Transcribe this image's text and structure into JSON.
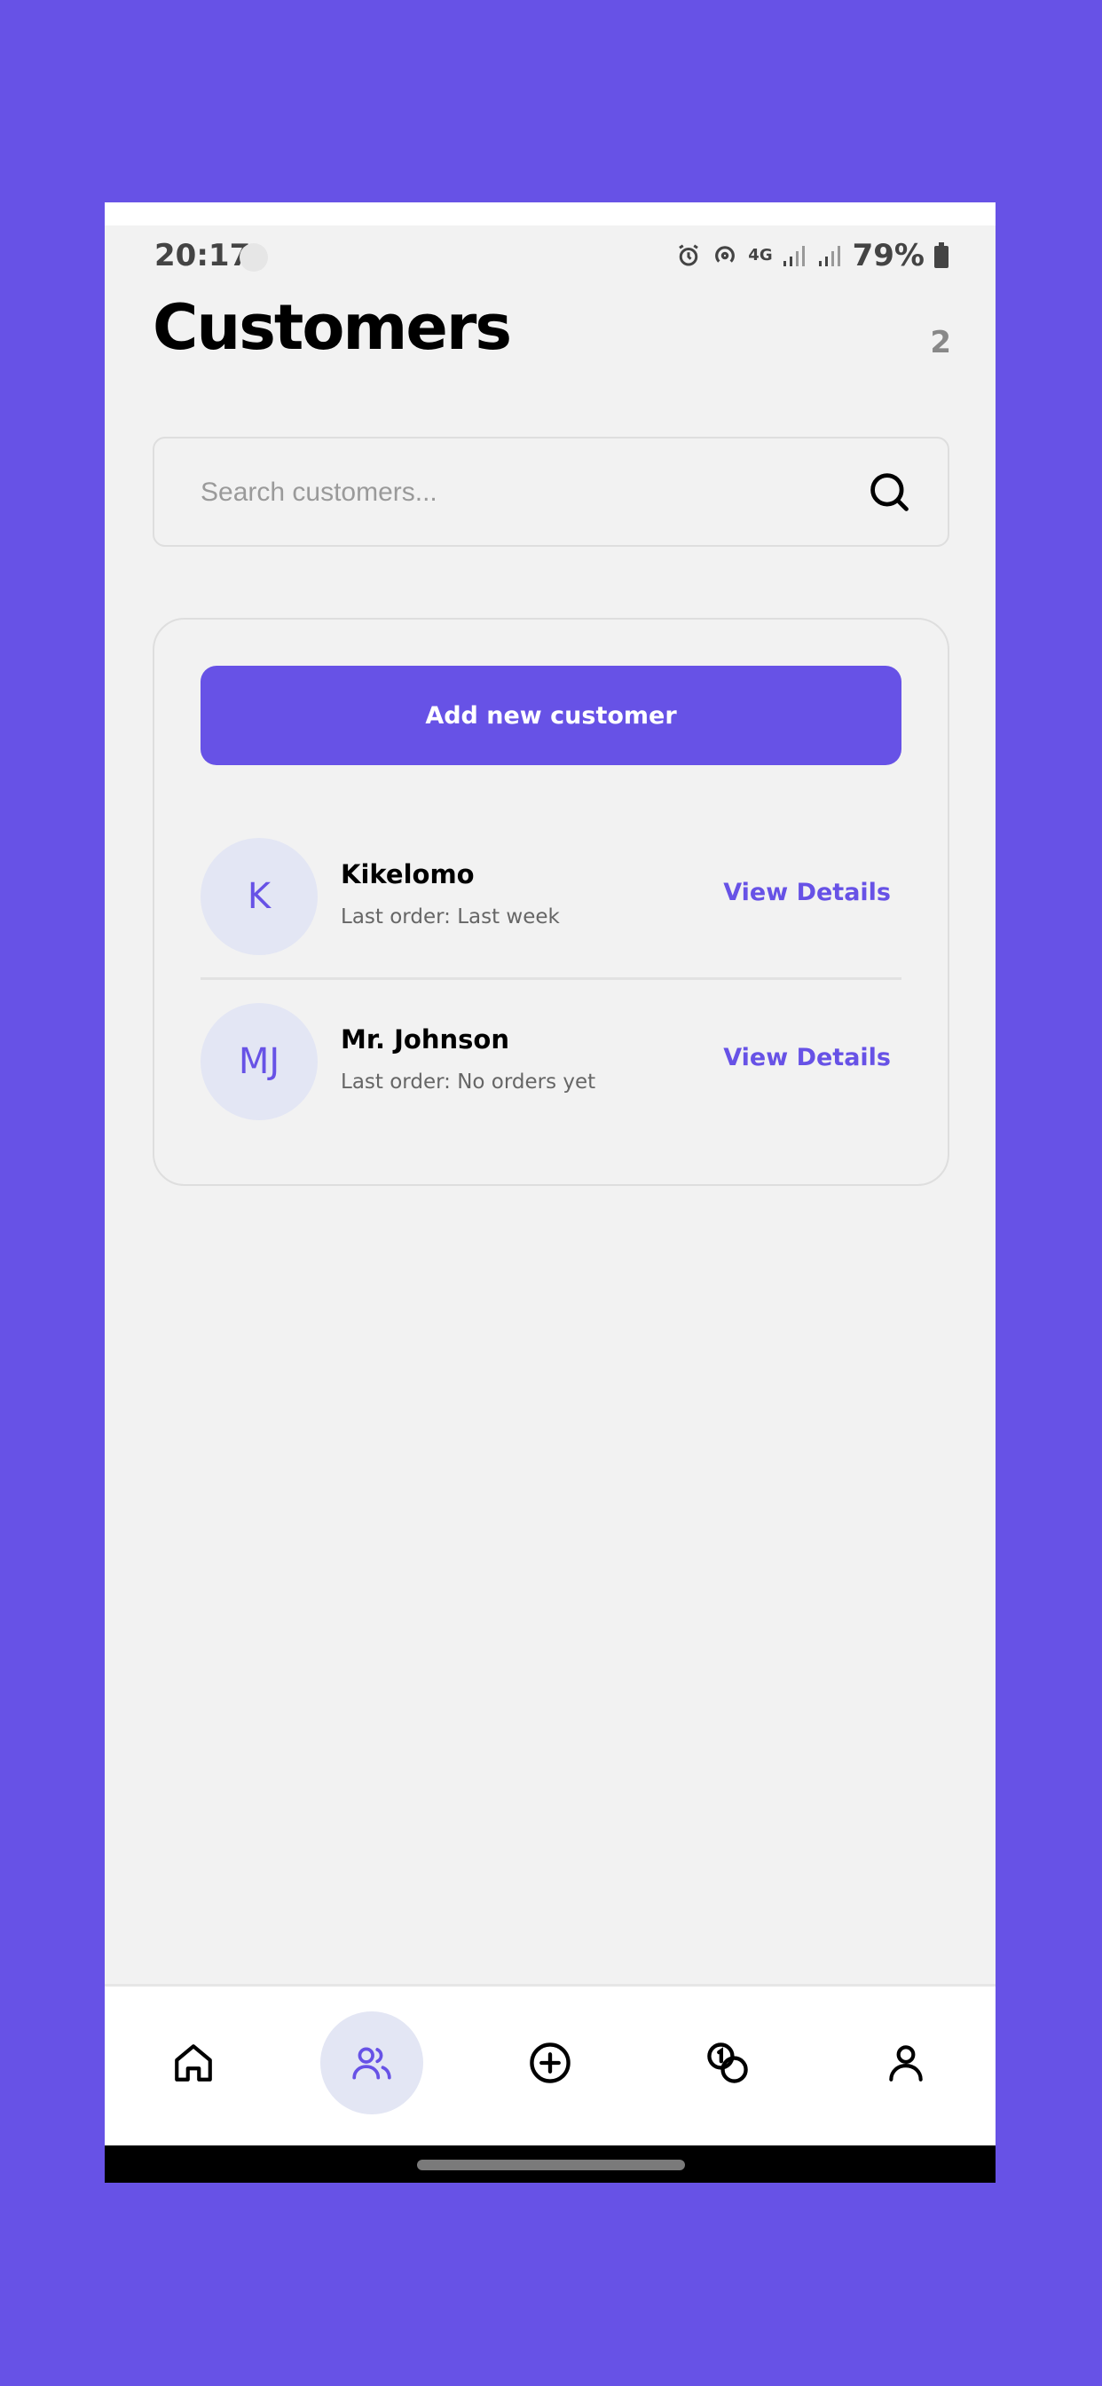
{
  "status_bar": {
    "time": "20:17",
    "network": "4G",
    "battery": "79%"
  },
  "header": {
    "title": "Customers",
    "count": "2"
  },
  "search": {
    "placeholder": "Search customers..."
  },
  "card": {
    "add_button_label": "Add new customer",
    "customers": [
      {
        "initials": "K",
        "name": "Kikelomo",
        "last_order": "Last order: Last week",
        "action": "View Details"
      },
      {
        "initials": "MJ",
        "name": "Mr. Johnson",
        "last_order": "Last order: No orders yet",
        "action": "View Details"
      }
    ]
  },
  "bottom_nav": {
    "items": [
      {
        "icon": "home-icon",
        "active": false
      },
      {
        "icon": "users-icon",
        "active": true
      },
      {
        "icon": "plus-circle-icon",
        "active": false
      },
      {
        "icon": "coins-icon",
        "active": false
      },
      {
        "icon": "profile-icon",
        "active": false
      }
    ]
  },
  "colors": {
    "accent": "#6752e6",
    "background": "#f2f2f2",
    "avatar_bg": "#e3e6f4"
  }
}
